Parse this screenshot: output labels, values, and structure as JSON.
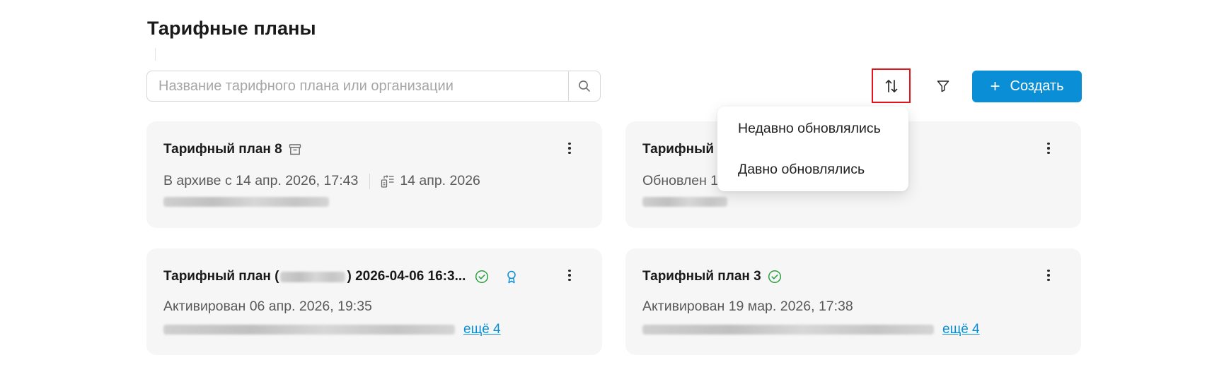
{
  "page": {
    "title": "Тарифные планы"
  },
  "search": {
    "placeholder": "Название тарифного плана или организации"
  },
  "toolbar": {
    "create_label": "Создать",
    "create_plus": "+"
  },
  "sort_menu": {
    "options": [
      "Недавно обновлялись",
      "Давно обновлялись"
    ]
  },
  "cards": [
    {
      "title": "Тарифный план 8",
      "status": "В архиве с 14 апр. 2026, 17:43",
      "date": "14 апр. 2026"
    },
    {
      "title": "Тарифный",
      "status": "Обновлен 1"
    },
    {
      "title_start": "Тарифный план (",
      "title_end": ") 2026-04-06 16:3...",
      "status": "Активирован 06 апр. 2026, 19:35",
      "more": "ещё 4"
    },
    {
      "title": "Тарифный план 3",
      "status": "Активирован 19 мар. 2026, 17:38",
      "more": "ещё 4"
    }
  ],
  "colors": {
    "accent": "#0a8fd6",
    "success": "#2ea043",
    "highlight": "#e3151a",
    "card_bg": "#f6f6f6"
  }
}
